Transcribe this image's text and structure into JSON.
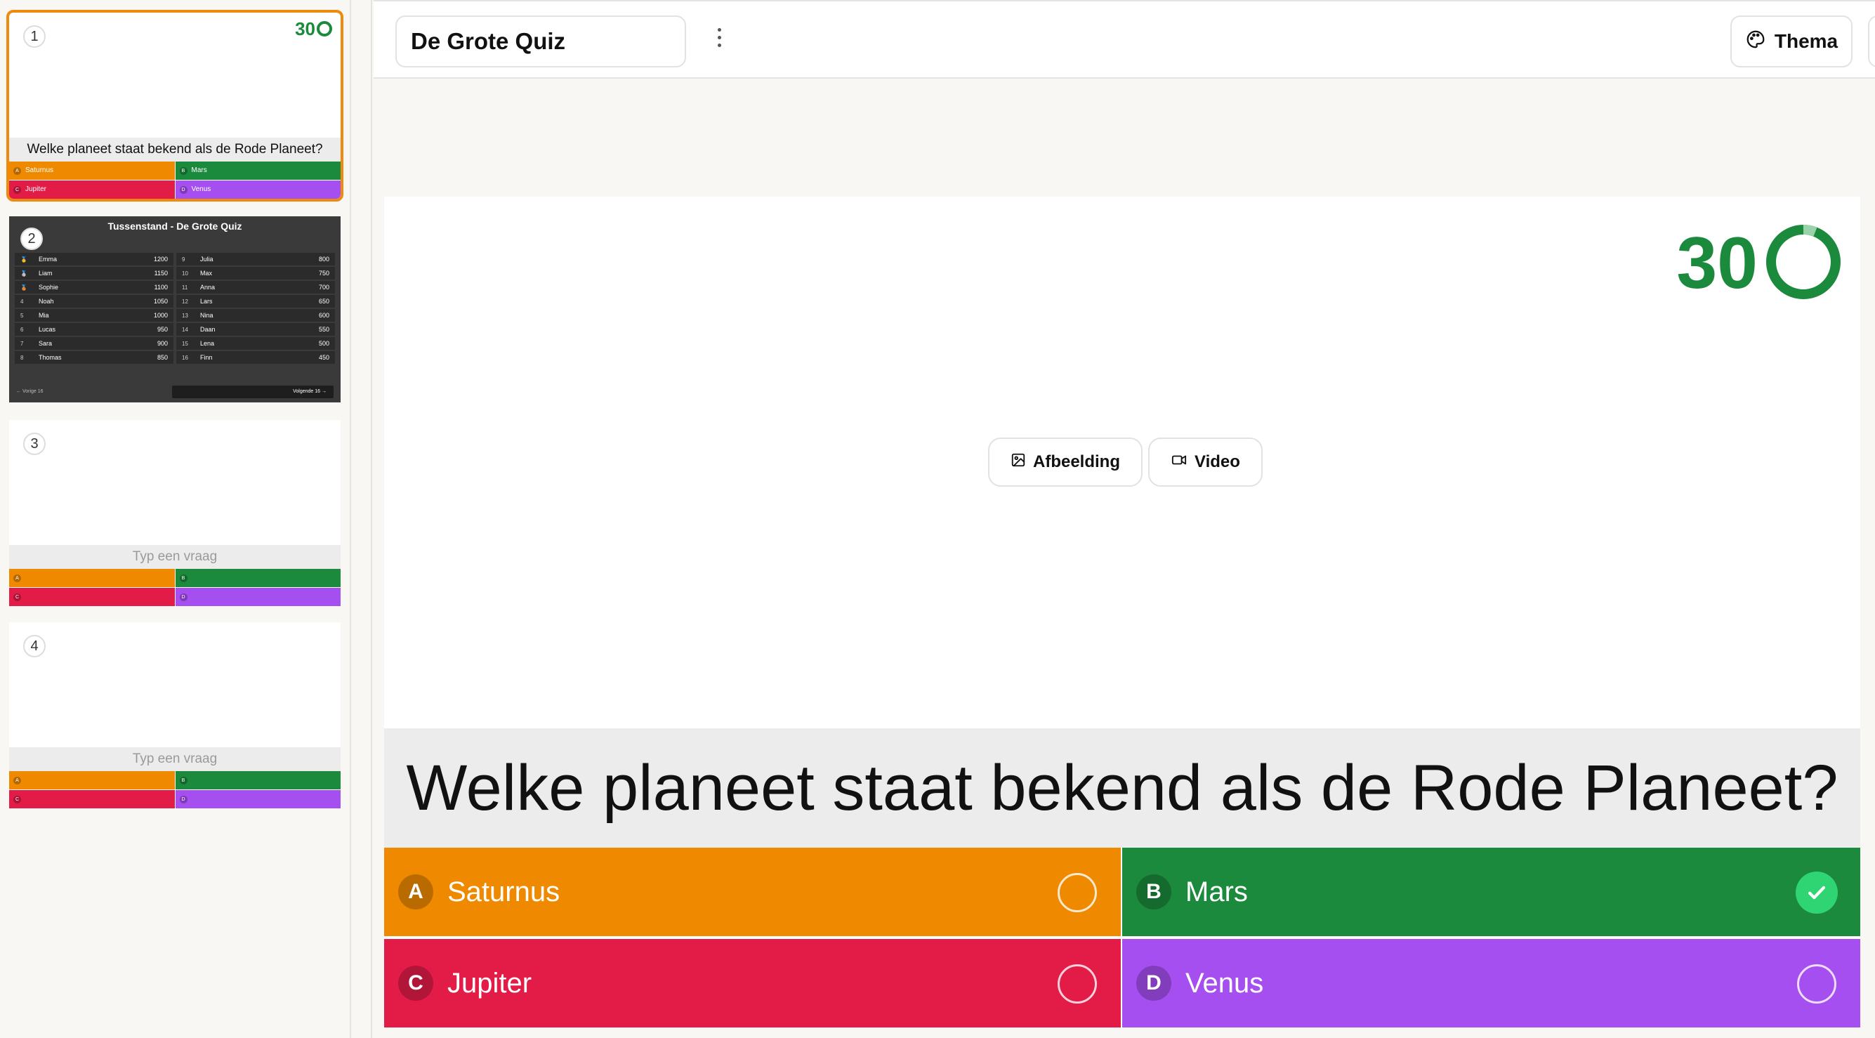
{
  "quiz_title": "De Grote Quiz",
  "toolbar": {
    "theme_label": "Thema"
  },
  "slides": [
    {
      "number": "1",
      "timer": "30",
      "question": "Welke planeet staat bekend als de Rode Planeet?",
      "answers": [
        {
          "letter": "A",
          "text": "Saturnus"
        },
        {
          "letter": "B",
          "text": "Mars"
        },
        {
          "letter": "C",
          "text": "Jupiter"
        },
        {
          "letter": "D",
          "text": "Venus"
        }
      ]
    },
    {
      "number": "2",
      "title": "Tussenstand - De Grote Quiz",
      "left": [
        {
          "rank": "🥇",
          "name": "Emma",
          "points": "1200"
        },
        {
          "rank": "🥈",
          "name": "Liam",
          "points": "1150"
        },
        {
          "rank": "🥉",
          "name": "Sophie",
          "points": "1100"
        },
        {
          "rank": "4",
          "name": "Noah",
          "points": "1050"
        },
        {
          "rank": "5",
          "name": "Mia",
          "points": "1000"
        },
        {
          "rank": "6",
          "name": "Lucas",
          "points": "950"
        },
        {
          "rank": "7",
          "name": "Sara",
          "points": "900"
        },
        {
          "rank": "8",
          "name": "Thomas",
          "points": "850"
        }
      ],
      "right": [
        {
          "rank": "9",
          "name": "Julia",
          "points": "800"
        },
        {
          "rank": "10",
          "name": "Max",
          "points": "750"
        },
        {
          "rank": "11",
          "name": "Anna",
          "points": "700"
        },
        {
          "rank": "12",
          "name": "Lars",
          "points": "650"
        },
        {
          "rank": "13",
          "name": "Nina",
          "points": "600"
        },
        {
          "rank": "14",
          "name": "Daan",
          "points": "550"
        },
        {
          "rank": "15",
          "name": "Lena",
          "points": "500"
        },
        {
          "rank": "16",
          "name": "Finn",
          "points": "450"
        }
      ],
      "prev_label": "Vorige 16",
      "next_label": "Volgende 16"
    },
    {
      "number": "3",
      "placeholder": "Typ een vraag",
      "letters": [
        "A",
        "B",
        "C",
        "D"
      ]
    },
    {
      "number": "4",
      "placeholder": "Typ een vraag",
      "letters": [
        "A",
        "B",
        "C",
        "D"
      ]
    }
  ],
  "editor": {
    "timer": "30",
    "image_label": "Afbeelding",
    "video_label": "Video",
    "question": "Welke planeet staat bekend als de Rode Planeet?",
    "answers": [
      {
        "letter": "A",
        "text": "Saturnus",
        "color": "#ef8a00",
        "correct": false
      },
      {
        "letter": "B",
        "text": "Mars",
        "color": "#1b8a3c",
        "correct": true
      },
      {
        "letter": "C",
        "text": "Jupiter",
        "color": "#e31b47",
        "correct": false
      },
      {
        "letter": "D",
        "text": "Venus",
        "color": "#a64ff0",
        "correct": false
      }
    ]
  },
  "colors": {
    "accent": "#ef8a10",
    "timer": "#1b8a3c",
    "correct": "#2fd573"
  }
}
